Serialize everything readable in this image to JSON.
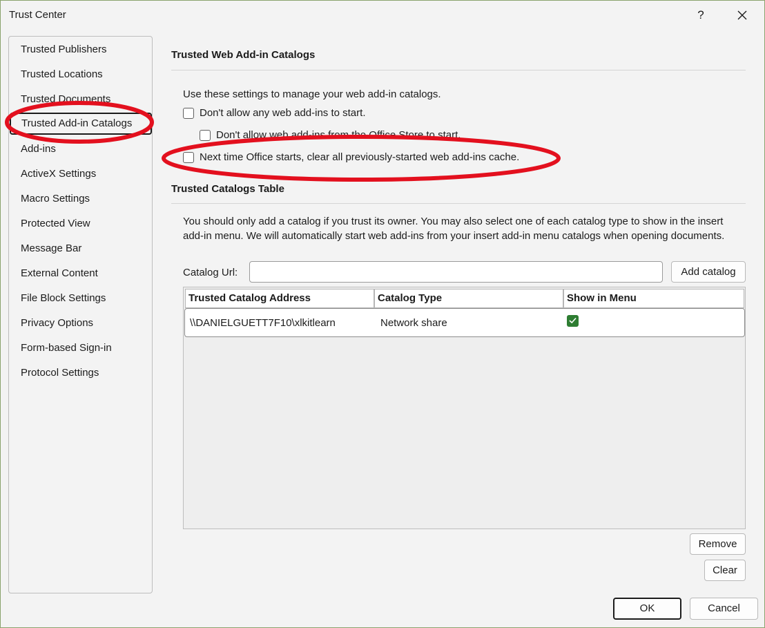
{
  "window": {
    "title": "Trust Center",
    "help_label": "?"
  },
  "sidebar": {
    "items": [
      {
        "label": "Trusted Publishers"
      },
      {
        "label": "Trusted Locations"
      },
      {
        "label": "Trusted Documents"
      },
      {
        "label": "Trusted Add-in Catalogs",
        "selected": true
      },
      {
        "label": "Add-ins"
      },
      {
        "label": "ActiveX Settings"
      },
      {
        "label": "Macro Settings"
      },
      {
        "label": "Protected View"
      },
      {
        "label": "Message Bar"
      },
      {
        "label": "External Content"
      },
      {
        "label": "File Block Settings"
      },
      {
        "label": "Privacy Options"
      },
      {
        "label": "Form-based Sign-in"
      },
      {
        "label": "Protocol Settings"
      }
    ]
  },
  "web_catalogs": {
    "title": "Trusted Web Add-in Catalogs",
    "intro": "Use these settings to manage your web add-in catalogs.",
    "options": [
      {
        "label": "Don't allow any web add-ins to start.",
        "checked": false
      },
      {
        "label": "Don't allow web add-ins from the Office Store to start.",
        "checked": false
      },
      {
        "label": "Next time Office starts, clear all previously-started web add-ins cache.",
        "checked": false
      }
    ]
  },
  "catalogs_table": {
    "title": "Trusted Catalogs Table",
    "description": "You should only add a catalog if you trust its owner. You may also select one of each catalog type to show in the insert add-in menu. We will automatically start web add-ins from your insert add-in menu catalogs when opening documents.",
    "url_label": "Catalog Url:",
    "url_value": "",
    "add_button": "Add catalog",
    "columns": [
      "Trusted Catalog Address",
      "Catalog Type",
      "Show in Menu"
    ],
    "rows": [
      {
        "address": "\\\\DANIELGUETT7F10\\xlkitlearn",
        "type": "Network share",
        "show_in_menu": true
      }
    ],
    "remove_button": "Remove",
    "clear_button": "Clear"
  },
  "footer": {
    "ok_label": "OK",
    "cancel_label": "Cancel"
  },
  "annotations": {
    "highlight_color": "#e3101e"
  }
}
